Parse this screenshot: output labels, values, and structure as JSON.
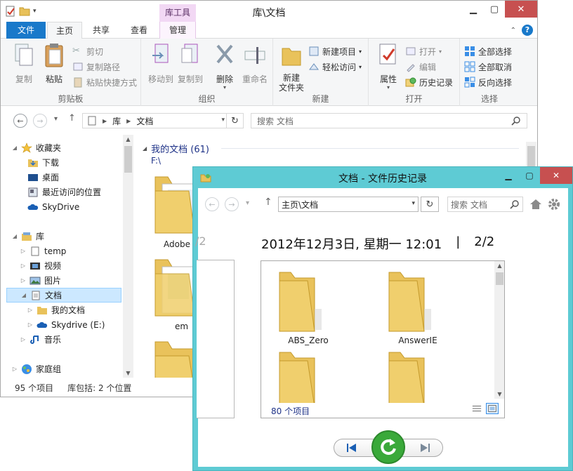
{
  "explorer": {
    "title": "库\\文档",
    "context_tab_header": "库工具",
    "tabs": {
      "file": "文件",
      "home": "主页",
      "share": "共享",
      "view": "查看",
      "manage": "管理"
    },
    "ribbon": {
      "clipboard": {
        "label": "剪贴板",
        "copy": "复制",
        "paste": "粘贴",
        "cut": "剪切",
        "copy_path": "复制路径",
        "paste_shortcut": "粘贴快捷方式"
      },
      "organize": {
        "label": "组织",
        "move_to": "移动到",
        "copy_to": "复制到",
        "delete": "删除",
        "rename": "重命名"
      },
      "new": {
        "label": "新建",
        "new_folder_line1": "新建",
        "new_folder_line2": "文件夹",
        "new_item": "新建项目",
        "easy_access": "轻松访问"
      },
      "open": {
        "label": "打开",
        "properties": "属性",
        "open": "打开",
        "edit": "编辑",
        "history": "历史记录"
      },
      "select": {
        "label": "选择",
        "select_all": "全部选择",
        "select_none": "全部取消",
        "invert": "反向选择"
      }
    },
    "address": {
      "crumbs": [
        "库",
        "文档"
      ]
    },
    "search_placeholder": "搜索 文档",
    "nav": {
      "favorites": "收藏夹",
      "downloads": "下载",
      "desktop": "桌面",
      "recent": "最近访问的位置",
      "skydrive": "SkyDrive",
      "libraries": "库",
      "temp": "temp",
      "videos": "视频",
      "pictures": "图片",
      "documents": "文档",
      "my_documents": "我的文档",
      "skydrive_e": "Skydrive (E:)",
      "music": "音乐",
      "homegroup": "家庭组"
    },
    "content": {
      "section_title": "我的文档 (61)",
      "section_path": "F:\\",
      "folders": [
        "Adobe",
        "em"
      ]
    },
    "status": {
      "items": "95 个项目",
      "library_includes": "库包括: 2 个位置"
    },
    "colors": {
      "file_tab": "#1979ca",
      "context_tab": "#f2d8f4",
      "selected_bg": "#cce8ff",
      "close_button": "#c75050"
    }
  },
  "history": {
    "title": "文档 - 文件历史记录",
    "address": "主页\\文档",
    "search_placeholder": "搜索 文档",
    "date": "2012年12月3日, 星期一 12:01",
    "separator": "|",
    "page": "2/2",
    "prev_page_ghost": "/2",
    "files": [
      "ABS_Zero",
      "AnswerIE"
    ],
    "status": "80 个项目",
    "colors": {
      "frame": "#5ecbd4",
      "restore_button": "#3aa93a"
    }
  }
}
